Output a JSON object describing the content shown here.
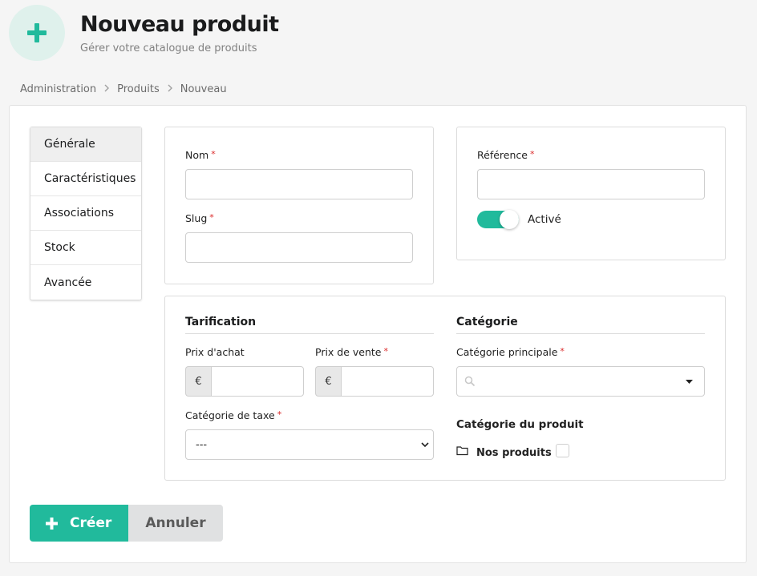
{
  "header": {
    "title": "Nouveau produit",
    "subtitle": "Gérer votre catalogue de produits",
    "icon": "plus-icon",
    "accent": "#21ba9c"
  },
  "breadcrumb": [
    "Administration",
    "Produits",
    "Nouveau"
  ],
  "tabs": [
    {
      "label": "Générale",
      "active": true
    },
    {
      "label": "Caractéristiques",
      "active": false
    },
    {
      "label": "Associations",
      "active": false
    },
    {
      "label": "Stock",
      "active": false
    },
    {
      "label": "Avancée",
      "active": false
    }
  ],
  "form": {
    "name_label": "Nom",
    "name_value": "",
    "slug_label": "Slug",
    "slug_value": "",
    "reference_label": "Référence",
    "reference_value": "",
    "enabled_label": "Activé",
    "enabled": true,
    "required_mark": "*"
  },
  "pricing": {
    "title": "Tarification",
    "purchase_label": "Prix d'achat",
    "sale_label": "Prix de vente",
    "currency_symbol": "€",
    "tax_label": "Catégorie de taxe",
    "tax_value": "---"
  },
  "category": {
    "title": "Catégorie",
    "main_label": "Catégorie principale",
    "main_value": "",
    "product_category_label": "Catégorie du produit",
    "tree_item": "Nos produits",
    "tree_item_checked": false
  },
  "actions": {
    "create_label": "Créer",
    "cancel_label": "Annuler"
  }
}
